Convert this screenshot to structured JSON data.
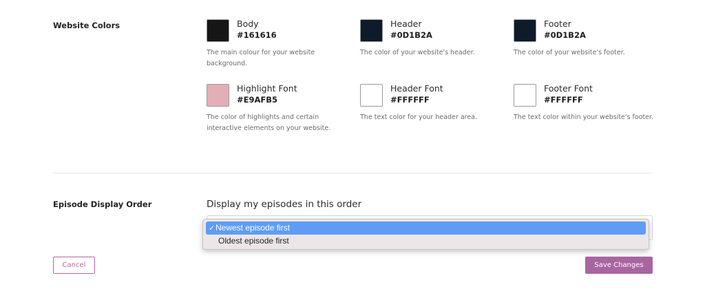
{
  "website_colors": {
    "section_label": "Website Colors",
    "swatches": [
      {
        "name": "Body",
        "hex": "#161616",
        "color": "#161616",
        "description": "The main colour for your website background."
      },
      {
        "name": "Header",
        "hex": "#0D1B2A",
        "color": "#0D1B2A",
        "description": "The color of your website's header."
      },
      {
        "name": "Footer",
        "hex": "#0D1B2A",
        "color": "#0D1B2A",
        "description": "The color of your website's footer."
      },
      {
        "name": "Highlight Font",
        "hex": "#E9AFB5",
        "color": "#E3AFB6",
        "description": "The color of highlights and certain interactive elements on your website."
      },
      {
        "name": "Header Font",
        "hex": "#FFFFFF",
        "color": "#FFFFFF",
        "description": "The text color for your header area."
      },
      {
        "name": "Footer Font",
        "hex": "#FFFFFF",
        "color": "#FFFFFF",
        "description": "The text color within your website's footer."
      }
    ]
  },
  "episode_order": {
    "section_label": "Episode Display Order",
    "heading": "Display my episodes in this order",
    "check_mark": "✓",
    "options": [
      {
        "label": "Newest episode first",
        "selected": true
      },
      {
        "label": "Oldest episode first",
        "selected": false
      }
    ]
  },
  "actions": {
    "cancel_label": "Cancel",
    "save_label": "Save Changes"
  },
  "colors": {
    "accent": "#A965A0",
    "selected_option": "#5F9CF4"
  }
}
